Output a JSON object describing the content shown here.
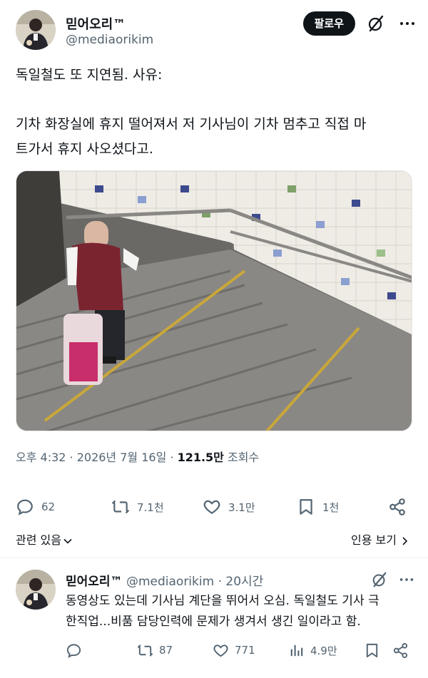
{
  "post": {
    "author_name": "믿어오리™",
    "author_handle": "@mediaorikim",
    "follow_label": "팔로우",
    "text_line1": "독일철도 또 지연됨. 사유:",
    "text_line2a": "기차 화장실에 휴지 떨어져서 저 기사님이 기차 멈추고 직접 마",
    "text_line2b": "트가서 휴지 사오셨다고.",
    "time_date": "오후 4:32 · 2026년 7월 16일 · ",
    "views_count": "121.5만",
    "views_label": " 조회수",
    "replies": "62",
    "reposts": "7.1천",
    "likes": "3.1만",
    "bookmarks": "1천",
    "related_label": "관련 있음",
    "quotes_label": "인용 보기"
  },
  "reply": {
    "author_name": "믿어오리™",
    "author_handle": "@mediaorikim",
    "time": " · 20시간",
    "text_line1": "동영상도 있는데 기사님 계단을 뛰어서 오심. 독일철도 기사 극",
    "text_line2": "한직업...비품 담당인력에 문제가 생겨서 생긴 일이라고 함.",
    "reposts": "87",
    "likes": "771",
    "views": "4.9만"
  },
  "colors": {
    "text": "#0f1419",
    "secondary": "#536471",
    "follow_bg": "#0f1419",
    "divider": "#eff3f4"
  },
  "icons": [
    "grok-icon",
    "more-icon",
    "reply-icon",
    "repost-icon",
    "like-icon",
    "bookmark-icon",
    "share-icon",
    "views-icon",
    "chevron-down-icon",
    "chevron-right-icon"
  ]
}
